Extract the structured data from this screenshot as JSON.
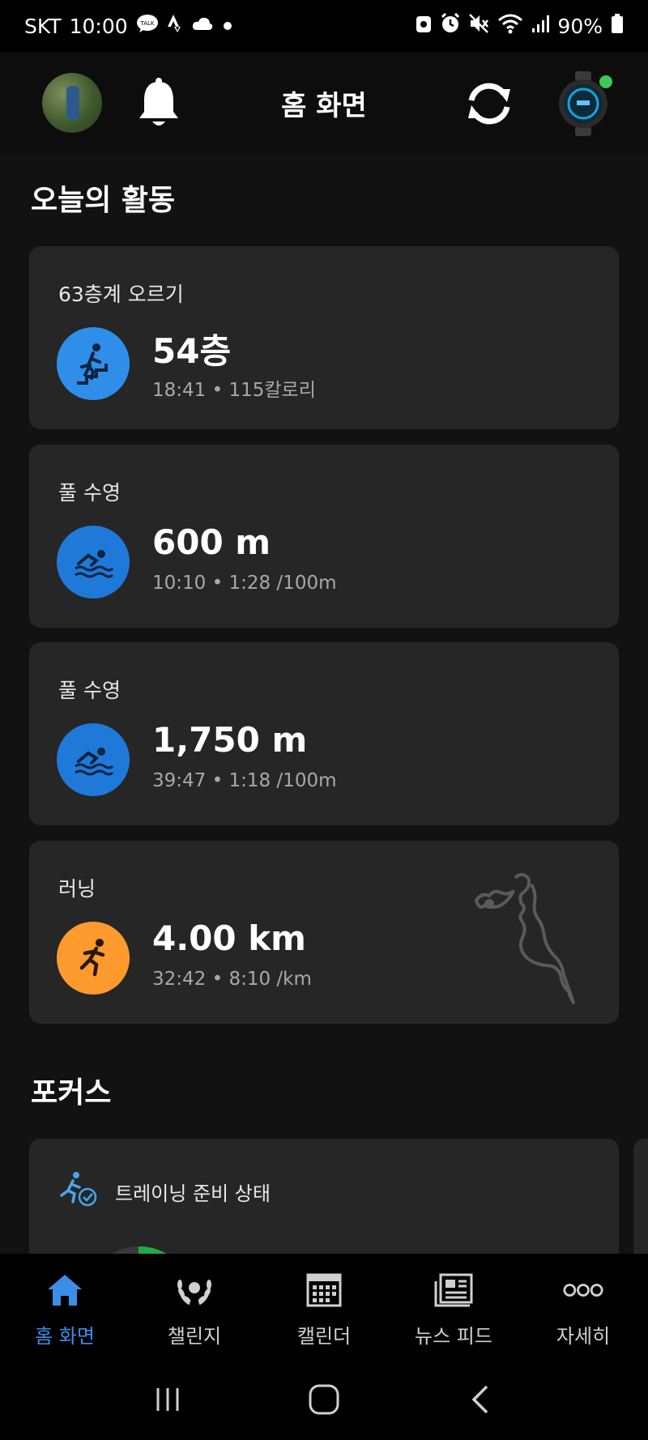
{
  "status_bar": {
    "carrier": "SKT",
    "time": "10:00",
    "battery": "90%"
  },
  "header": {
    "title": "홈 화면"
  },
  "today": {
    "section_title": "오늘의 활동",
    "activities": [
      {
        "label": "63층계 오르기",
        "value": "54층",
        "detail": "18:41 • 115칼로리",
        "icon": "stair-climbing-icon",
        "color": "#2f8eea"
      },
      {
        "label": "풀 수영",
        "value": "600 m",
        "detail": "10:10 • 1:28 /100m",
        "icon": "swimming-icon",
        "color": "#1f79d9"
      },
      {
        "label": "풀 수영",
        "value": "1,750 m",
        "detail": "39:47 • 1:18 /100m",
        "icon": "swimming-icon",
        "color": "#1f79d9"
      },
      {
        "label": "러닝",
        "value": "4.00 km",
        "detail": "32:42 • 8:10 /km",
        "icon": "running-icon",
        "color": "#ff9a2e"
      }
    ]
  },
  "focus": {
    "section_title": "포커스",
    "card_label": "트레이닝 준비 상태",
    "icon": "training-readiness-icon"
  },
  "bottom_nav": {
    "items": [
      {
        "label": "홈 화면",
        "icon": "home-icon",
        "active": true
      },
      {
        "label": "챌린지",
        "icon": "laurel-icon",
        "active": false
      },
      {
        "label": "캘린더",
        "icon": "calendar-icon",
        "active": false
      },
      {
        "label": "뉴스 피드",
        "icon": "newsfeed-icon",
        "active": false
      },
      {
        "label": "자세히",
        "icon": "more-icon",
        "active": false
      }
    ]
  },
  "colors": {
    "accent": "#3b8ee8",
    "card_bg": "#262626",
    "page_bg": "#121212",
    "watch_status": "#3cc95a",
    "gauge_green": "#1faa4a"
  }
}
